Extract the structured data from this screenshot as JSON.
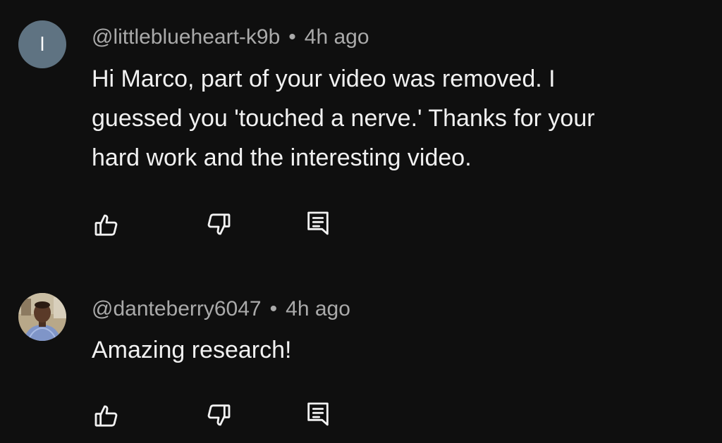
{
  "icons": {
    "like": "thumbs-up-icon",
    "dislike": "thumbs-down-icon",
    "reply": "reply-icon"
  },
  "colors": {
    "background": "#0f0f0f",
    "text_primary": "#f1f1f1",
    "text_secondary": "#aaaaaa",
    "letter_avatar_bg": "#5f7382"
  },
  "comments": [
    {
      "avatar_letter": "l",
      "handle": "@littleblueheart-k9b",
      "separator": "•",
      "time": "4h ago",
      "text_lines": [
        "Hi Marco, part of your video was removed.  I",
        "guessed you 'touched a nerve.'  Thanks for your",
        "hard work and the interesting video."
      ]
    },
    {
      "avatar_letter": "",
      "handle": "@danteberry6047",
      "separator": "•",
      "time": "4h ago",
      "text_lines": [
        "Amazing research!"
      ]
    }
  ]
}
